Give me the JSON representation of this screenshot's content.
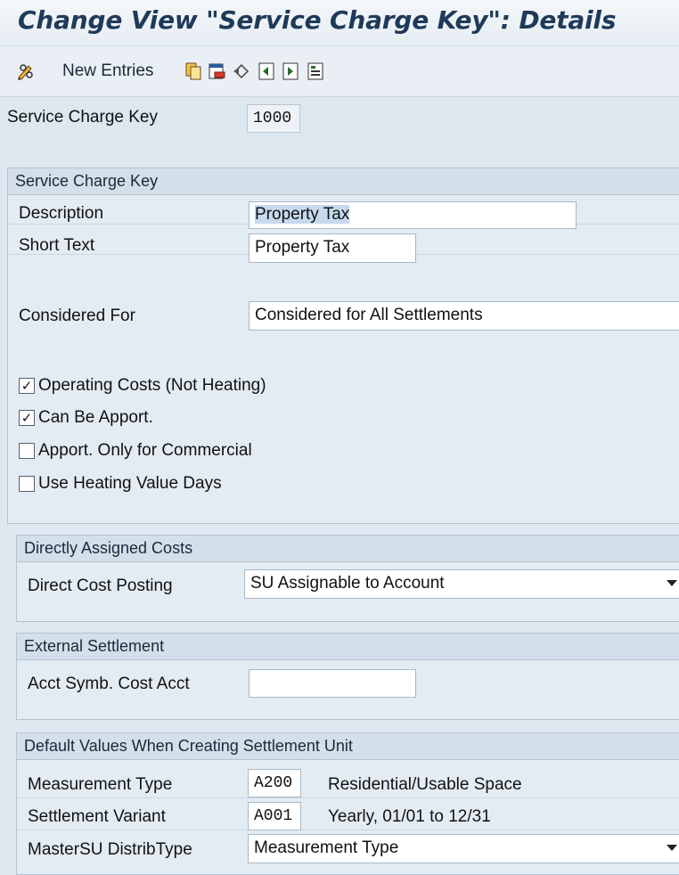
{
  "window": {
    "title": "Change View \"Service Charge Key\": Details"
  },
  "toolbar": {
    "new_entries_label": "New Entries",
    "icons": [
      "pencil-glasses-icon",
      "copy-icon",
      "delete-icon",
      "undo-icon",
      "prev-entry-icon",
      "next-entry-icon",
      "select-block-icon"
    ]
  },
  "header": {
    "key_label": "Service Charge Key",
    "key_value": "1000"
  },
  "sections": {
    "service_charge_key": {
      "title": "Service Charge Key",
      "description_label": "Description",
      "description_value": "Property Tax",
      "short_text_label": "Short Text",
      "short_text_value": "Property Tax",
      "considered_for_label": "Considered For",
      "considered_for_value": "Considered for All Settlements",
      "checkboxes": [
        {
          "label": "Operating Costs (Not Heating)",
          "checked": true
        },
        {
          "label": "Can Be Apport.",
          "checked": true
        },
        {
          "label": "Apport. Only for Commercial",
          "checked": false
        },
        {
          "label": "Use Heating Value Days",
          "checked": false
        }
      ]
    },
    "directly_assigned_costs": {
      "title": "Directly Assigned Costs",
      "direct_cost_posting_label": "Direct Cost Posting",
      "direct_cost_posting_value": "SU Assignable to Account"
    },
    "external_settlement": {
      "title": "External Settlement",
      "acct_symb_label": "Acct Symb. Cost Acct",
      "acct_symb_value": ""
    },
    "default_values": {
      "title": "Default Values When Creating Settlement Unit",
      "measurement_type_label": "Measurement Type",
      "measurement_type_code": "A200",
      "measurement_type_text": "Residential/Usable Space",
      "settlement_variant_label": "Settlement Variant",
      "settlement_variant_code": "A001",
      "settlement_variant_text": "Yearly, 01/01 to 12/31",
      "mastersu_label": "MasterSU DistribType",
      "mastersu_value": "Measurement Type"
    }
  },
  "colors": {
    "title_text": "#1f3a59",
    "background": "#dfe8f0",
    "panel_header": "#d3dfea",
    "selection_highlight": "#c6d9ee"
  }
}
